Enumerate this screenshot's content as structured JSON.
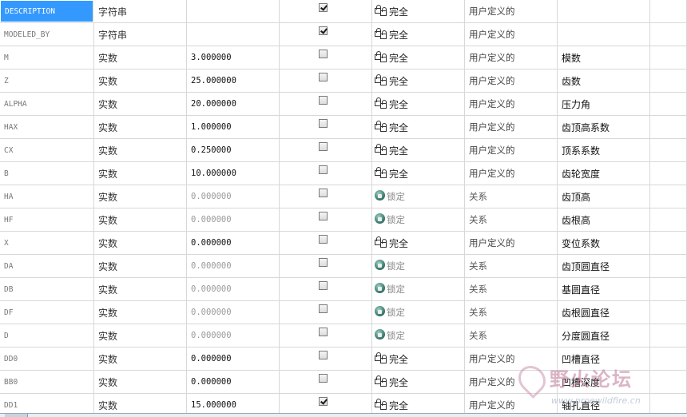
{
  "columns": [
    "name",
    "type",
    "value",
    "designate",
    "access",
    "source",
    "description"
  ],
  "rows": [
    {
      "name": "DESCRIPTION",
      "type": "字符串",
      "value": "",
      "checked": true,
      "access": "完全",
      "access_kind": "full",
      "source": "用户定义的",
      "desc": "",
      "dim": false,
      "selected": true
    },
    {
      "name": "MODELED_BY",
      "type": "字符串",
      "value": "",
      "checked": true,
      "access": "完全",
      "access_kind": "full",
      "source": "用户定义的",
      "desc": "",
      "dim": false
    },
    {
      "name": "M",
      "type": "实数",
      "value": "3.000000",
      "checked": false,
      "access": "完全",
      "access_kind": "full",
      "source": "用户定义的",
      "desc": "模数",
      "dim": false
    },
    {
      "name": "Z",
      "type": "实数",
      "value": "25.000000",
      "checked": false,
      "access": "完全",
      "access_kind": "full",
      "source": "用户定义的",
      "desc": "齿数",
      "dim": false
    },
    {
      "name": "ALPHA",
      "type": "实数",
      "value": "20.000000",
      "checked": false,
      "access": "完全",
      "access_kind": "full",
      "source": "用户定义的",
      "desc": "压力角",
      "dim": false
    },
    {
      "name": "HAX",
      "type": "实数",
      "value": "1.000000",
      "checked": false,
      "access": "完全",
      "access_kind": "full",
      "source": "用户定义的",
      "desc": "齿顶高系数",
      "dim": false
    },
    {
      "name": "CX",
      "type": "实数",
      "value": "0.250000",
      "checked": false,
      "access": "完全",
      "access_kind": "full",
      "source": "用户定义的",
      "desc": "顶系系数",
      "dim": false
    },
    {
      "name": "B",
      "type": "实数",
      "value": "10.000000",
      "checked": false,
      "access": "完全",
      "access_kind": "full",
      "source": "用户定义的",
      "desc": "齿轮宽度",
      "dim": false
    },
    {
      "name": "HA",
      "type": "实数",
      "value": "0.000000",
      "checked": false,
      "access": "锁定",
      "access_kind": "locked",
      "source": "关系",
      "desc": "齿顶高",
      "dim": true
    },
    {
      "name": "HF",
      "type": "实数",
      "value": "0.000000",
      "checked": false,
      "access": "锁定",
      "access_kind": "locked",
      "source": "关系",
      "desc": "齿根高",
      "dim": true
    },
    {
      "name": "X",
      "type": "实数",
      "value": "0.000000",
      "checked": false,
      "access": "完全",
      "access_kind": "full",
      "source": "用户定义的",
      "desc": "变位系数",
      "dim": false
    },
    {
      "name": "DA",
      "type": "实数",
      "value": "0.000000",
      "checked": false,
      "access": "锁定",
      "access_kind": "locked",
      "source": "关系",
      "desc": "齿顶圆直径",
      "dim": true
    },
    {
      "name": "DB",
      "type": "实数",
      "value": "0.000000",
      "checked": false,
      "access": "锁定",
      "access_kind": "locked",
      "source": "关系",
      "desc": "基圆直径",
      "dim": true
    },
    {
      "name": "DF",
      "type": "实数",
      "value": "0.000000",
      "checked": false,
      "access": "锁定",
      "access_kind": "locked",
      "source": "关系",
      "desc": "齿根圆直径",
      "dim": true
    },
    {
      "name": "D",
      "type": "实数",
      "value": "0.000000",
      "checked": false,
      "access": "锁定",
      "access_kind": "locked",
      "source": "关系",
      "desc": "分度圆直径",
      "dim": true
    },
    {
      "name": "DD0",
      "type": "实数",
      "value": "0.000000",
      "checked": false,
      "access": "完全",
      "access_kind": "full",
      "source": "用户定义的",
      "desc": "凹槽直径",
      "dim": false
    },
    {
      "name": "BB0",
      "type": "实数",
      "value": "0.000000",
      "checked": false,
      "access": "完全",
      "access_kind": "full",
      "source": "用户定义的",
      "desc": "凹槽深度",
      "dim": false
    },
    {
      "name": "DD1",
      "type": "实数",
      "value": "15.000000",
      "checked": true,
      "access": "完全",
      "access_kind": "full",
      "source": "用户定义的",
      "desc": "轴孔直径",
      "dim": false
    }
  ],
  "watermark": {
    "title": "野火论坛",
    "url": "www.proewildfire.cn"
  }
}
